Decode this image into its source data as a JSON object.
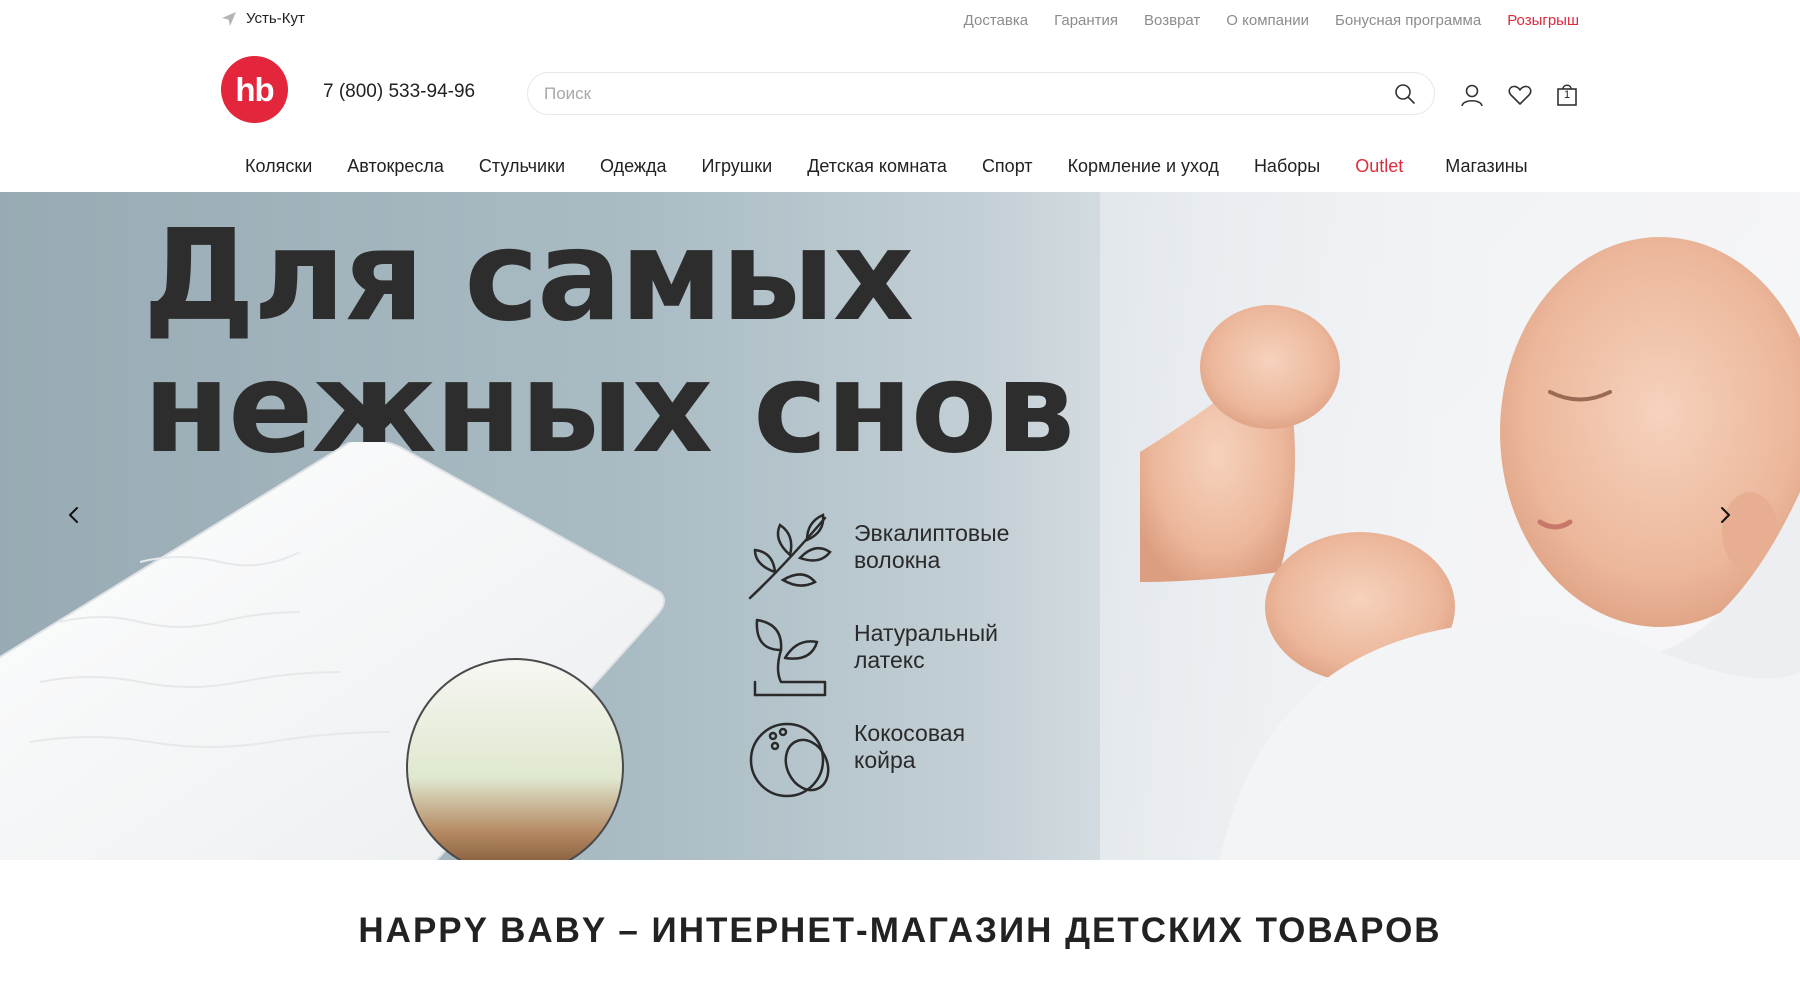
{
  "topbar": {
    "city": "Усть-Кут",
    "links": [
      {
        "label": "Доставка"
      },
      {
        "label": "Гарантия"
      },
      {
        "label": "Возврат"
      },
      {
        "label": "О компании"
      },
      {
        "label": "Бонусная программа"
      },
      {
        "label": "Розыгрыш"
      }
    ]
  },
  "header": {
    "logo_text": "hb",
    "phone": "7 (800) 533-94-96",
    "search_placeholder": "Поиск",
    "search_value": "",
    "cart_count": "1"
  },
  "nav": {
    "items": [
      {
        "label": "Коляски"
      },
      {
        "label": "Автокресла"
      },
      {
        "label": "Стульчики"
      },
      {
        "label": "Одежда"
      },
      {
        "label": "Игрушки"
      },
      {
        "label": "Детская комната"
      },
      {
        "label": "Спорт"
      },
      {
        "label": "Кормление и уход"
      },
      {
        "label": "Наборы"
      },
      {
        "label": "Outlet"
      },
      {
        "label": "Магазины"
      }
    ]
  },
  "hero": {
    "title_line1": "Для самых",
    "title_line2": "нежных снов",
    "features": [
      {
        "line1": "Эвкалиптовые",
        "line2": "волокна",
        "icon": "eucalyptus-branch-icon"
      },
      {
        "line1": "Натуральный",
        "line2": "латекс",
        "icon": "sprout-icon"
      },
      {
        "line1": "Кокосовая",
        "line2": "койра",
        "icon": "coconut-icon"
      }
    ]
  },
  "main": {
    "heading": "HAPPY BABY – ИНТЕРНЕТ-МАГАЗИН ДЕТСКИХ ТОВАРОВ"
  },
  "colors": {
    "brand": "#e3263b",
    "accent_link": "#e02a3d",
    "text": "#222222",
    "muted": "#8c8c8c"
  }
}
